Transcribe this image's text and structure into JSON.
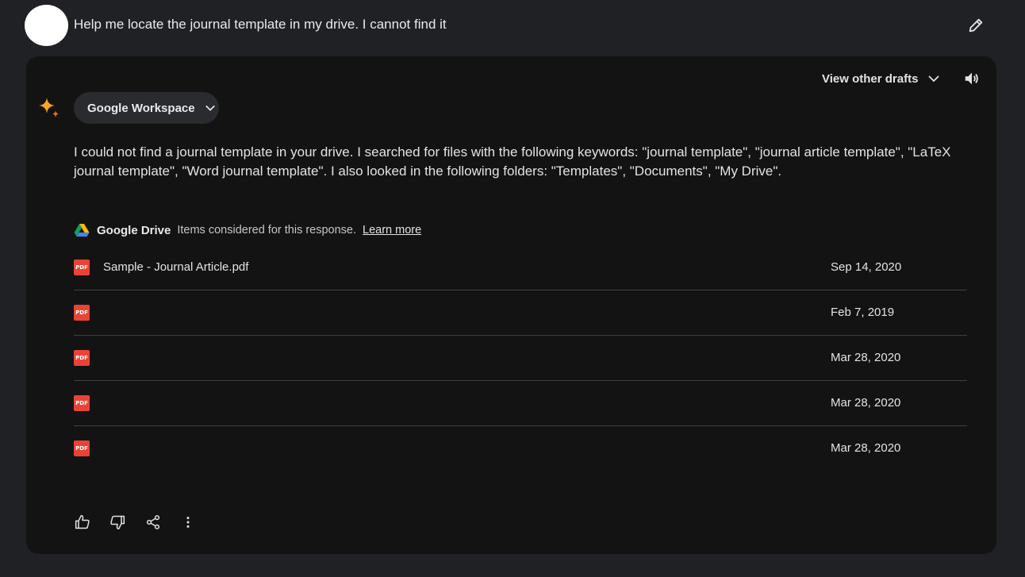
{
  "user": {
    "query": "Help me locate the journal template in my drive. I cannot find it",
    "edit_icon": "pencil-icon"
  },
  "response": {
    "view_drafts_label": "View other drafts",
    "extension_chip": "Google Workspace",
    "answer": "I could not find a journal template in your drive. I searched for files with the following keywords: \"journal template\", \"journal article template\", \"LaTeX journal template\", \"Word journal template\". I also looked in the following folders: \"Templates\", \"Documents\", \"My Drive\".",
    "source": {
      "name": "Google Drive",
      "note": "Items considered for this response.",
      "learn_more": "Learn more"
    },
    "files": [
      {
        "name": "Sample - Journal Article.pdf",
        "date": "Sep 14, 2020",
        "icon_label": "PDF"
      },
      {
        "name": "",
        "date": "Feb 7, 2019",
        "icon_label": "PDF"
      },
      {
        "name": "",
        "date": "Mar 28, 2020",
        "icon_label": "PDF"
      },
      {
        "name": "",
        "date": "Mar 28, 2020",
        "icon_label": "PDF"
      },
      {
        "name": "",
        "date": "Mar 28, 2020",
        "icon_label": "PDF"
      }
    ],
    "actions": [
      "thumbs-up-icon",
      "thumbs-down-icon",
      "share-icon",
      "more-vert-icon"
    ]
  },
  "colors": {
    "page_background": "#202124",
    "card_background": "#131314",
    "chip_background": "#2a2b2e",
    "pdf_red": "#ea4335",
    "divider": "#3c4043"
  }
}
